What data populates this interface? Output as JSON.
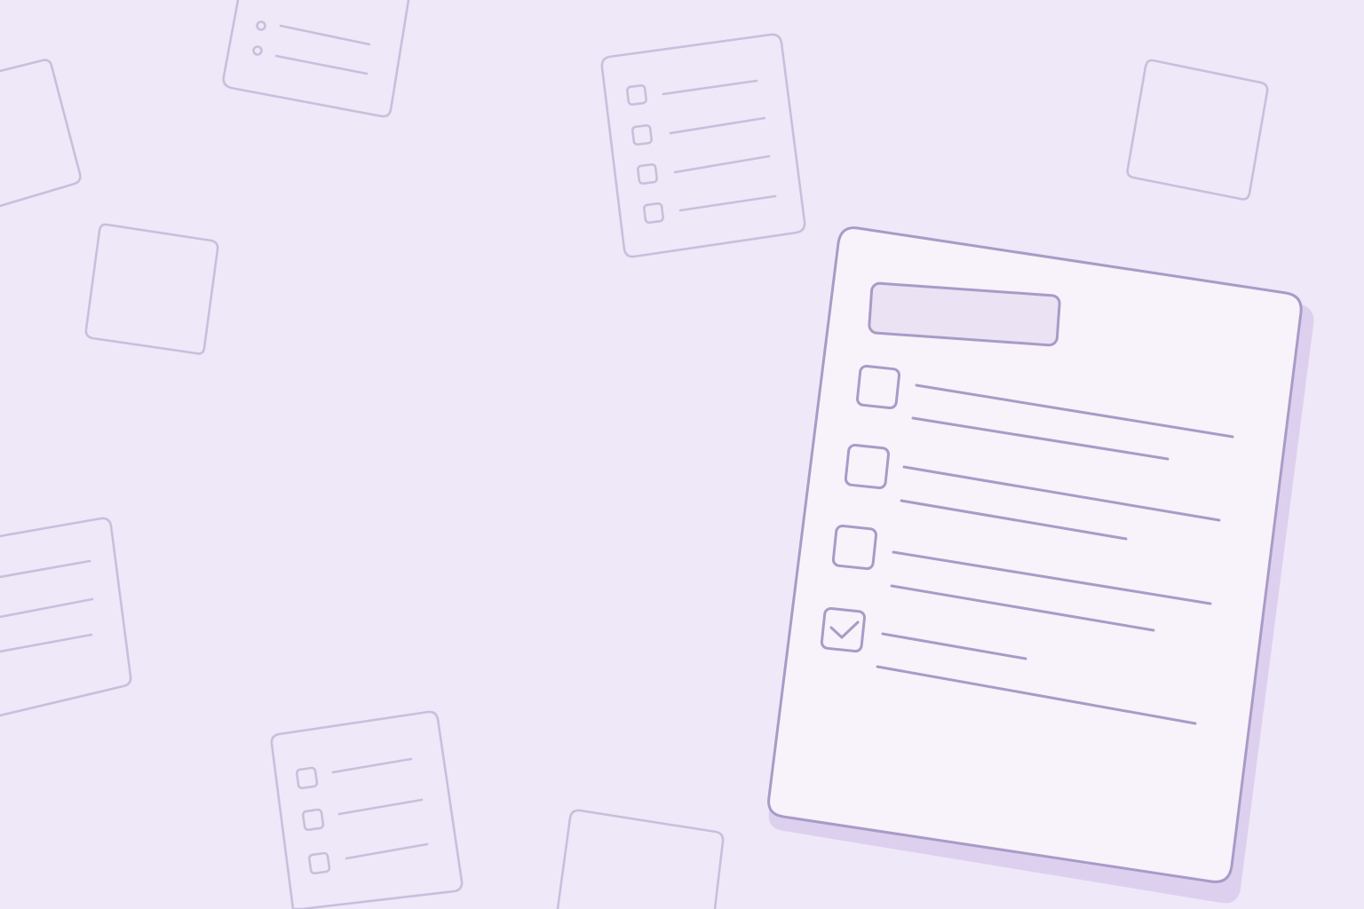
{
  "theme": {
    "background": "#efe8f8",
    "outline_faint": "#c6bcd9",
    "outline_strong": "#a89bc8",
    "card_fill": "#f8f2fa",
    "card_shadow": "#ddd0ef",
    "title_bar_fill": "#ebe3f4"
  },
  "main_checklist": {
    "icon": "checklist-card-icon",
    "items": [
      {
        "checked": false
      },
      {
        "checked": false
      },
      {
        "checked": false
      },
      {
        "checked": true
      }
    ]
  },
  "background_decorations": {
    "icons": [
      "checklist-card-icon",
      "blank-card-icon",
      "bullet-list-card-icon",
      "lined-card-icon"
    ]
  }
}
